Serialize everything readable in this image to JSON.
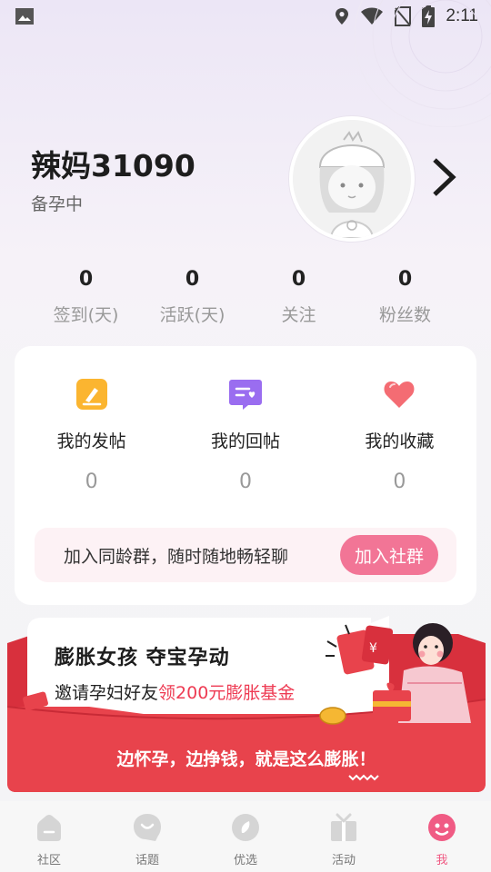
{
  "status_bar": {
    "time": "2:11",
    "icons": [
      "image-icon",
      "location-icon",
      "wifi-icon",
      "no-sim-icon",
      "battery-charging-icon"
    ]
  },
  "profile": {
    "username": "辣妈31090",
    "status": "备孕中",
    "avatar": "avatar-icon"
  },
  "stats": [
    {
      "value": "0",
      "label": "签到(天)"
    },
    {
      "value": "0",
      "label": "活跃(天)"
    },
    {
      "value": "0",
      "label": "关注"
    },
    {
      "value": "0",
      "label": "粉丝数"
    }
  ],
  "features": [
    {
      "label": "我的发帖",
      "count": "0",
      "icon": "post-icon",
      "color": "#fbb530"
    },
    {
      "label": "我的回帖",
      "count": "0",
      "icon": "reply-icon",
      "color": "#9a6df0"
    },
    {
      "label": "我的收藏",
      "count": "0",
      "icon": "heart-icon",
      "color": "#f46c73"
    }
  ],
  "group_banner": {
    "text": "加入同龄群，随时随地畅轻聊",
    "button": "加入社群"
  },
  "promo": {
    "title": "膨胀女孩  夺宝孕动",
    "subtitle_prefix": "邀请孕妇好友",
    "subtitle_highlight": "领200元膨胀基金",
    "slogan": "边怀孕，边挣钱，就是这么膨胀！",
    "accent": "#ee3b53"
  },
  "tabs": [
    {
      "label": "社区",
      "icon": "home-icon"
    },
    {
      "label": "话题",
      "icon": "smile-icon"
    },
    {
      "label": "优选",
      "icon": "leaf-icon"
    },
    {
      "label": "活动",
      "icon": "gift-icon"
    },
    {
      "label": "我",
      "icon": "face-icon",
      "active": true
    }
  ]
}
